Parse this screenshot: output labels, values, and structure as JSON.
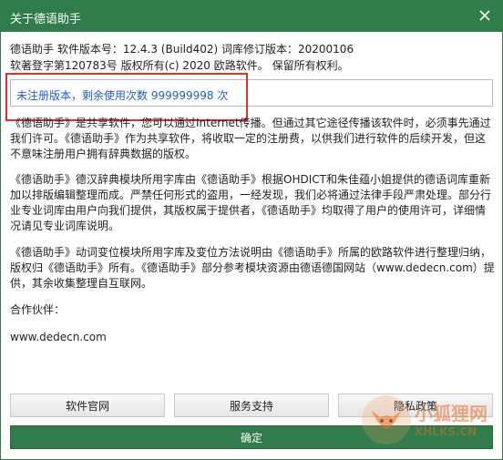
{
  "window": {
    "title": "关于德语助手",
    "close_icon": "close-icon"
  },
  "info": {
    "version_line": "德语助手 软件版本号：12.4.3 (Build402)   词库修订版本：20200106",
    "copyright_line": "软著登字第120783号 版权所有(c) 2020 欧路软件。 保留所有权利。"
  },
  "registration": {
    "status_text": "未注册版本，剩余使用次数 999999998 次"
  },
  "paragraphs": [
    "《德语助手》是共享软件，您可以通过Internet传播。但通过其它途径传播该软件时，必须事先通过我们许可。《德语助手》作为共享软件，将收取一定的注册费，以供我们进行软件的后续开发，但这不意味注册用户拥有辞典数据的版权。",
    "《德语助手》德汉辞典模块所用字库由《德语助手》根据OHDICT和朱佳蕴小姐提供的德语词库重新加以排版编辑整理而成。严禁任何形式的盗用，一经发现，我们必将通过法律手段严肃处理。部分行业专业词库由用户向我们提供，其版权属于提供者，《德语助手》均取得了用户的使用许可，详细情况请见专业词库说明。",
    "《德语助手》动词变位模块所用字库及变位方法说明由《德语助手》所属的欧路软件进行整理归纳，版权归《德语助手》所有。《德语助手》部分参考模块资源由德语德国网站（www.dedecn.com）提供，其余收集整理自互联网。",
    "合作伙伴：",
    "www.dedecn.com"
  ],
  "buttons": {
    "website": "软件官网",
    "support": "服务支持",
    "privacy": "隐私政策",
    "ok": "确定"
  },
  "watermark": {
    "main": "小狐狸网",
    "sub": "XHLKS.CN"
  },
  "colors": {
    "titlebar": "#2e7d4a",
    "registration_text": "#1f5fc8",
    "highlight_border": "#e0302a"
  }
}
